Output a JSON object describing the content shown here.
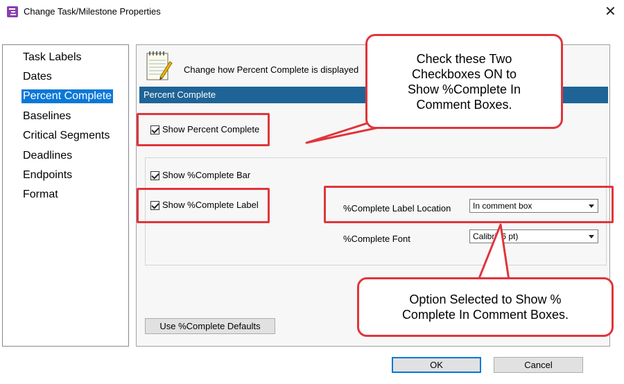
{
  "window": {
    "title": "Change Task/Milestone Properties",
    "close_glyph": "✕"
  },
  "nav": {
    "items": [
      "Task Labels",
      "Dates",
      "Percent Complete",
      "Baselines",
      "Critical Segments",
      "Deadlines",
      "Endpoints",
      "Format"
    ],
    "selected_index": 2
  },
  "header": {
    "description": "Change how Percent Complete is displayed"
  },
  "section": {
    "title": "Percent Complete"
  },
  "options": {
    "show_percent_complete": {
      "label": "Show Percent Complete",
      "checked": true
    },
    "show_complete_bar": {
      "label": "Show %Complete Bar",
      "checked": true
    },
    "show_complete_label": {
      "label": "Show %Complete Label",
      "checked": true
    }
  },
  "fields": {
    "label_location": {
      "label": "%Complete Label Location",
      "value": "In comment box"
    },
    "font": {
      "label": "%Complete Font",
      "value": "Calibri (6 pt)"
    }
  },
  "buttons": {
    "defaults": "Use %Complete Defaults",
    "ok": "OK",
    "cancel": "Cancel"
  },
  "callouts": {
    "checkboxes": [
      "Check these Two",
      "Checkboxes ON to",
      "Show %Complete In",
      "Comment Boxes."
    ],
    "option": [
      "Option Selected to Show %",
      "Complete In Comment Boxes."
    ]
  },
  "colors": {
    "accent": "#0a78d7",
    "section_bar": "#1e6496",
    "annotation": "#e0353b"
  }
}
